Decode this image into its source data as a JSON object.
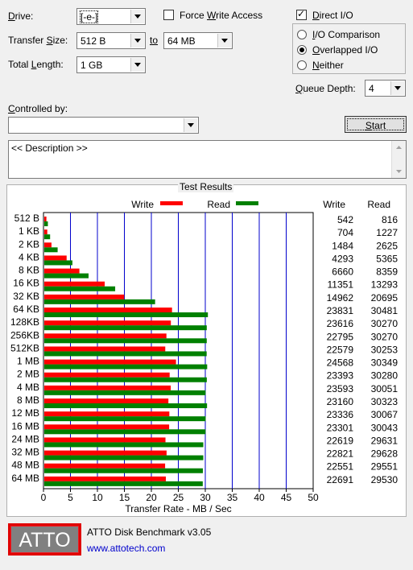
{
  "drive": {
    "label_pre": "",
    "label_u": "D",
    "label_post": "rive:",
    "value": "[-e-]"
  },
  "transfer_size": {
    "label_pre": "Transfer ",
    "label_u": "S",
    "label_post": "ize:",
    "from": "512 B",
    "to_label": "to",
    "to": "64 MB"
  },
  "total_length": {
    "label_pre": "Total ",
    "label_u": "L",
    "label_post": "ength:",
    "value": "1 GB"
  },
  "force_write_access": {
    "pre": "Force ",
    "u": "W",
    "post": "rite Access",
    "checked": false
  },
  "direct_io": {
    "pre": "",
    "u": "D",
    "post": "irect I/O",
    "checked": true
  },
  "io_mode": {
    "comparison": {
      "pre": "",
      "u": "I",
      "post": "/O Comparison",
      "selected": false
    },
    "overlapped": {
      "pre": "",
      "u": "O",
      "post": "verlapped I/O",
      "selected": true
    },
    "neither": {
      "pre": "",
      "u": "N",
      "post": "either",
      "selected": false
    }
  },
  "queue_depth": {
    "label_pre": "",
    "label_u": "Q",
    "label_post": "ueue Depth:",
    "value": "4"
  },
  "controlled_by": {
    "label_pre": "",
    "label_u": "C",
    "label_post": "ontrolled by:",
    "value": ""
  },
  "start_button": {
    "pre": "",
    "u": "S",
    "post": "tart"
  },
  "description": "<< Description >>",
  "test_results": {
    "title": "Test Results",
    "legend_write": "Write",
    "legend_read": "Read",
    "col_write": "Write",
    "col_read": "Read",
    "xlabel": "Transfer Rate - MB / Sec"
  },
  "colors": {
    "write": "#ff0000",
    "read": "#008000",
    "grid": "#0000cc",
    "logo_border": "#e00000"
  },
  "chart_data": {
    "type": "bar",
    "orientation": "horizontal",
    "xlim": [
      0,
      50
    ],
    "xticks": [
      "0",
      "5",
      "10",
      "15",
      "20",
      "25",
      "30",
      "35",
      "40",
      "45",
      "50"
    ],
    "xlabel": "Transfer Rate - MB / Sec",
    "categories": [
      "512 B",
      "1 KB",
      "2 KB",
      "4 KB",
      "8 KB",
      "16 KB",
      "32 KB",
      "64 KB",
      "128KB",
      "256KB",
      "512KB",
      "1 MB",
      "2 MB",
      "4 MB",
      "8 MB",
      "12 MB",
      "16 MB",
      "24 MB",
      "32 MB",
      "48 MB",
      "64 MB"
    ],
    "series": [
      {
        "name": "Write",
        "values": [
          542,
          704,
          1484,
          4293,
          6660,
          11351,
          14962,
          23831,
          23616,
          22795,
          22579,
          24568,
          23393,
          23593,
          23160,
          23336,
          23301,
          22619,
          22821,
          22551,
          22691
        ]
      },
      {
        "name": "Read",
        "values": [
          816,
          1227,
          2625,
          5365,
          8359,
          13293,
          20695,
          30481,
          30270,
          30270,
          30253,
          30349,
          30280,
          30051,
          30323,
          30067,
          30043,
          29631,
          29628,
          29551,
          29530
        ]
      }
    ],
    "value_scale": 1000,
    "legend": "top"
  },
  "footer": {
    "logo": "ATTO",
    "product": "ATTO Disk Benchmark v3.05",
    "url": "www.attotech.com"
  }
}
